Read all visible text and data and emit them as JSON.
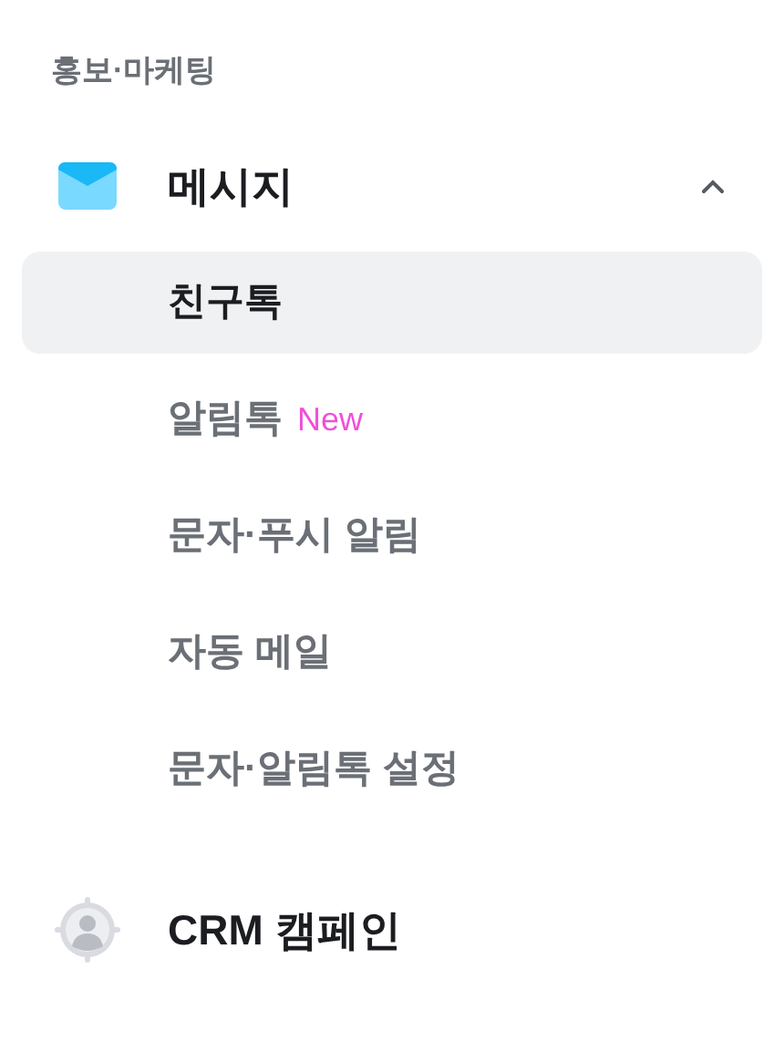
{
  "section_label": "홍보·마케팅",
  "groups": [
    {
      "label": "메시지",
      "kind": "message",
      "expanded": true,
      "children": [
        {
          "label": "친구톡",
          "selected": true
        },
        {
          "label": "알림톡",
          "selected": false,
          "badge": "New"
        },
        {
          "label": "문자·푸시 알림",
          "selected": false
        },
        {
          "label": "자동 메일",
          "selected": false
        },
        {
          "label": "문자·알림톡 설정",
          "selected": false
        }
      ]
    },
    {
      "label": "CRM 캠페인",
      "kind": "crm"
    }
  ]
}
